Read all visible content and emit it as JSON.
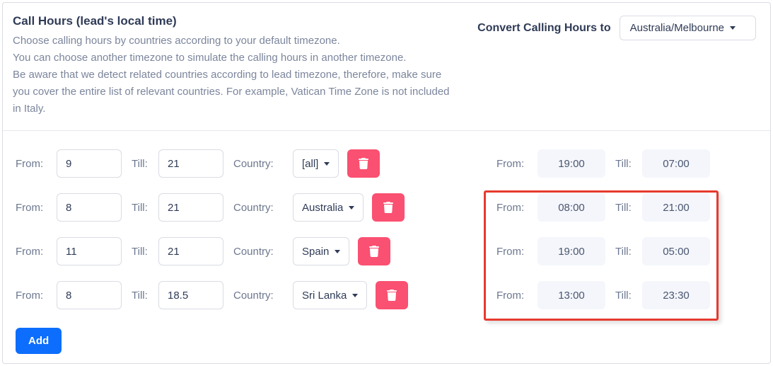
{
  "header": {
    "title": "Call Hours (lead's local time)",
    "desc_line1": "Choose calling hours by countries according to your default timezone.",
    "desc_line2": "You can choose another timezone to simulate the calling hours in another timezone.",
    "desc_line3": "Be aware that we detect related countries according to lead timezone, therefore, make sure you cover the entire list of relevant countries. For example, Vatican Time Zone is not included in Italy.",
    "convert_label": "Convert Calling Hours to",
    "timezone": "Australia/Melbourne"
  },
  "labels": {
    "from": "From:",
    "till": "Till:",
    "country": "Country:",
    "add": "Add"
  },
  "rules": [
    {
      "from": "9",
      "till": "21",
      "country": "[all]"
    },
    {
      "from": "8",
      "till": "21",
      "country": "Australia"
    },
    {
      "from": "11",
      "till": "21",
      "country": "Spain"
    },
    {
      "from": "8",
      "till": "18.5",
      "country": "Sri Lanka"
    }
  ],
  "converted": [
    {
      "from": "19:00",
      "till": "07:00"
    },
    {
      "from": "08:00",
      "till": "21:00"
    },
    {
      "from": "19:00",
      "till": "05:00"
    },
    {
      "from": "13:00",
      "till": "23:30"
    }
  ]
}
